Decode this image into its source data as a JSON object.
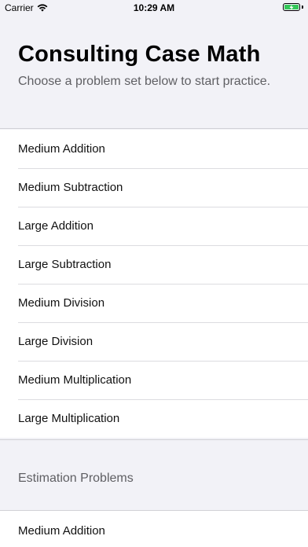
{
  "status_bar": {
    "carrier": "Carrier",
    "time": "10:29 AM",
    "wifi_icon": "wifi-icon",
    "battery_icon": "battery-charging-icon",
    "battery_color": "#34c759"
  },
  "header": {
    "title": "Consulting Case Math",
    "subtitle": "Choose a problem set below to start practice."
  },
  "problem_sets": [
    {
      "label": "Medium Addition"
    },
    {
      "label": "Medium Subtraction"
    },
    {
      "label": "Large Addition"
    },
    {
      "label": "Large Subtraction"
    },
    {
      "label": "Medium Division"
    },
    {
      "label": "Large Division"
    },
    {
      "label": "Medium Multiplication"
    },
    {
      "label": "Large Multiplication"
    }
  ],
  "estimation_section": {
    "title": "Estimation Problems",
    "items": [
      {
        "label": "Medium Addition"
      }
    ]
  }
}
